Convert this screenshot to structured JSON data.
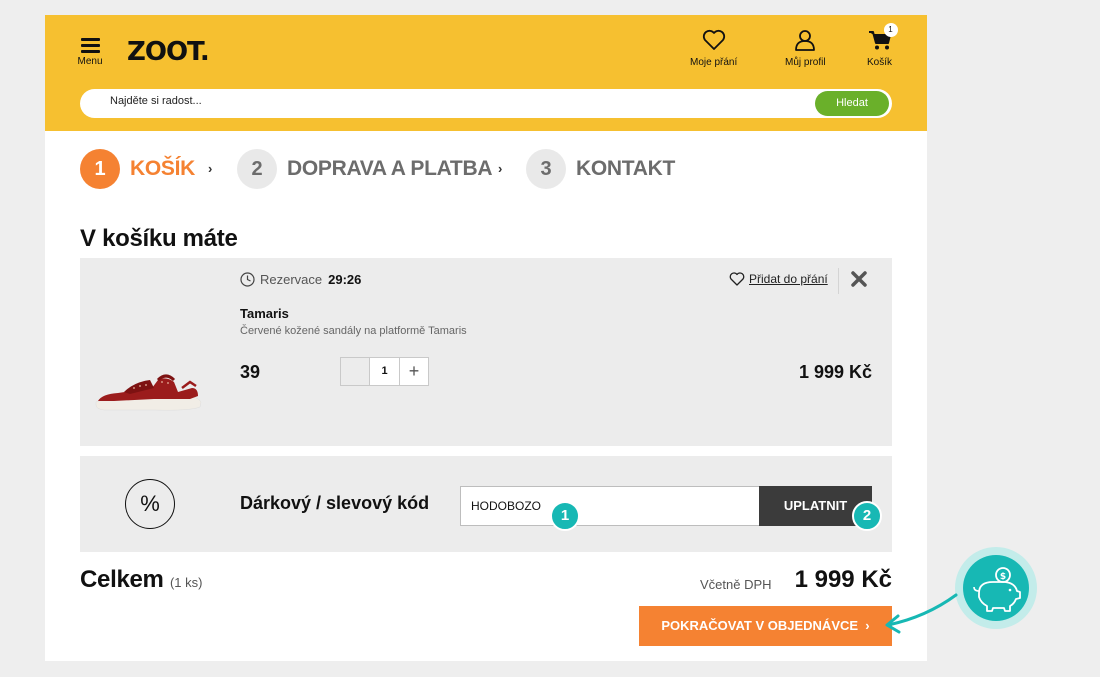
{
  "header": {
    "menu_label": "Menu",
    "logo": "ZOOT.",
    "wishlist_label": "Moje přání",
    "profile_label": "Můj profil",
    "cart_label": "Košík",
    "cart_count": "1",
    "search_placeholder": "Najděte si radost...",
    "search_button": "Hledat"
  },
  "steps": [
    {
      "num": "1",
      "label": "KOŠÍK"
    },
    {
      "num": "2",
      "label": "DOPRAVA A PLATBA"
    },
    {
      "num": "3",
      "label": "KONTAKT"
    }
  ],
  "cart": {
    "title": "V košíku máte",
    "item": {
      "reservation_label": "Rezervace",
      "reservation_time": "29:26",
      "wish_label": "Přidat do přání",
      "brand": "Tamaris",
      "description": "Červené kožené sandály na platformě Tamaris",
      "size": "39",
      "quantity": "1",
      "price": "1 999 Kč"
    }
  },
  "voucher": {
    "icon": "%",
    "label": "Dárkový / slevový kód",
    "code_value": "HODOBOZO",
    "apply_button": "UPLATNIT",
    "marker1": "1",
    "marker2": "2"
  },
  "summary": {
    "total_label": "Celkem",
    "total_qty": "(1 ks)",
    "vat_label": "Včetně DPH",
    "total_price": "1 999 Kč",
    "continue_button": "POKRAČOVAT V OBJEDNÁVCE"
  },
  "colors": {
    "header": "#f6c030",
    "accent": "#f58232",
    "search_button": "#6ab02a",
    "marker": "#17b8b4"
  },
  "icons": [
    "hamburger-menu-icon",
    "heart-icon",
    "user-icon",
    "cart-icon",
    "clock-icon",
    "close-icon",
    "percent-icon",
    "piggy-bank-icon",
    "chevron-right-icon"
  ]
}
